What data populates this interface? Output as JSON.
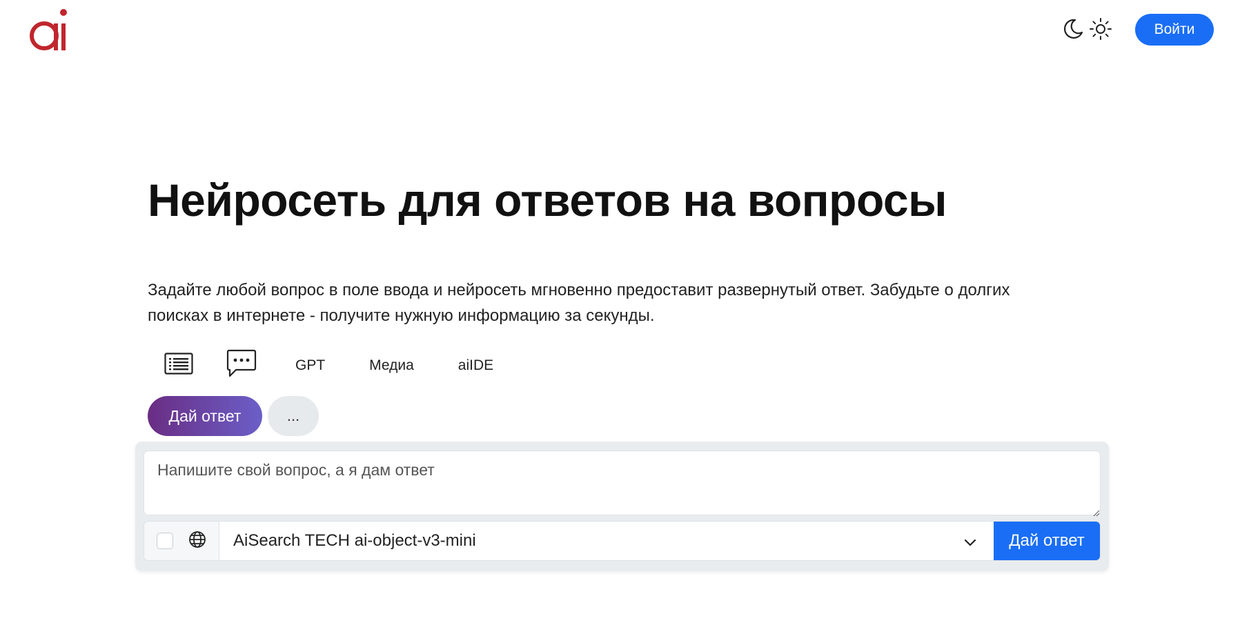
{
  "header": {
    "logo_text": "ai",
    "moon_icon": "moon-icon",
    "sun_icon": "sun-icon",
    "login_label": "Войти"
  },
  "hero": {
    "title": "Нейросеть для ответов на вопросы",
    "lead": "Задайте любой вопрос в поле ввода и нейросеть мгновенно предоставит развернутый ответ. Забудьте о долгих поисках в интернете - получите нужную информацию за секунды."
  },
  "modes": {
    "items": [
      {
        "icon": "list-icon"
      },
      {
        "icon": "chat-bubble-icon"
      },
      {
        "label": "GPT"
      },
      {
        "label": "Медиа"
      },
      {
        "label": "aiIDE"
      }
    ]
  },
  "pills": {
    "primary_label": "Дай ответ",
    "more_label": "..."
  },
  "composer": {
    "placeholder": "Напишите свой вопрос, а я дам ответ",
    "web_search_checked": false,
    "globe_icon": "globe-icon",
    "model_selected": "AiSearch TECH ai-object-v3-mini",
    "send_label": "Дай ответ"
  },
  "colors": {
    "brand_red": "#c0262d",
    "primary_blue": "#1a6ef5",
    "gradient_start": "#6a2d83",
    "gradient_end": "#6b5fc8"
  }
}
